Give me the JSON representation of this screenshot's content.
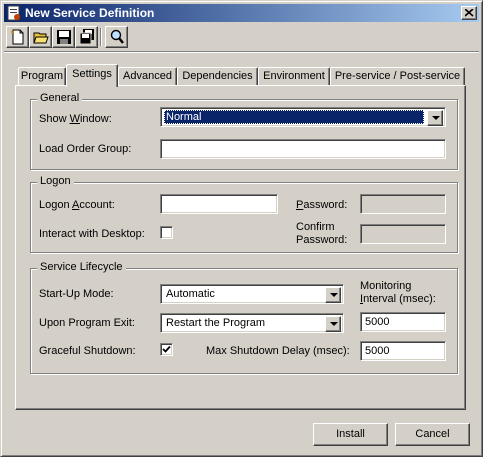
{
  "window": {
    "title": "New Service Definition"
  },
  "toolbar": {
    "buttons": [
      {
        "name": "new-icon"
      },
      {
        "name": "open-folder-icon"
      },
      {
        "name": "save-icon"
      },
      {
        "name": "save-all-icon"
      },
      {
        "name": "find-icon"
      }
    ]
  },
  "tabs": [
    "Program",
    "Settings",
    "Advanced",
    "Dependencies",
    "Environment",
    "Pre-service / Post-service"
  ],
  "active_tab": "Settings",
  "general": {
    "legend": "General",
    "show_window_label": "Show Window:",
    "show_window_value": "Normal",
    "load_order_label": "Load Order Group:",
    "load_order_value": ""
  },
  "logon": {
    "legend": "Logon",
    "account_label": "Logon Account:",
    "account_value": "",
    "password_label": "Password:",
    "password_value": "",
    "interact_label": "Interact with Desktop:",
    "interact_checked": false,
    "confirm_label_1": "Confirm",
    "confirm_label_2": "Password:",
    "confirm_value": ""
  },
  "lifecycle": {
    "legend": "Service Lifecycle",
    "startup_label": "Start-Up Mode:",
    "startup_value": "Automatic",
    "monitor_label_1": "Monitoring",
    "monitor_label_2": "Interval (msec):",
    "monitor_value": "5000",
    "exit_label": "Upon Program Exit:",
    "exit_value": "Restart the Program",
    "graceful_label": "Graceful Shutdown:",
    "graceful_checked": true,
    "max_delay_label": "Max Shutdown Delay (msec):",
    "max_delay_value": "5000"
  },
  "footer": {
    "install_label": "Install",
    "cancel_label": "Cancel"
  },
  "colors": {
    "titlebar_start": "#0a246a",
    "titlebar_end": "#a6caf0",
    "face": "#d4d0c8",
    "selection": "#0a246a"
  }
}
